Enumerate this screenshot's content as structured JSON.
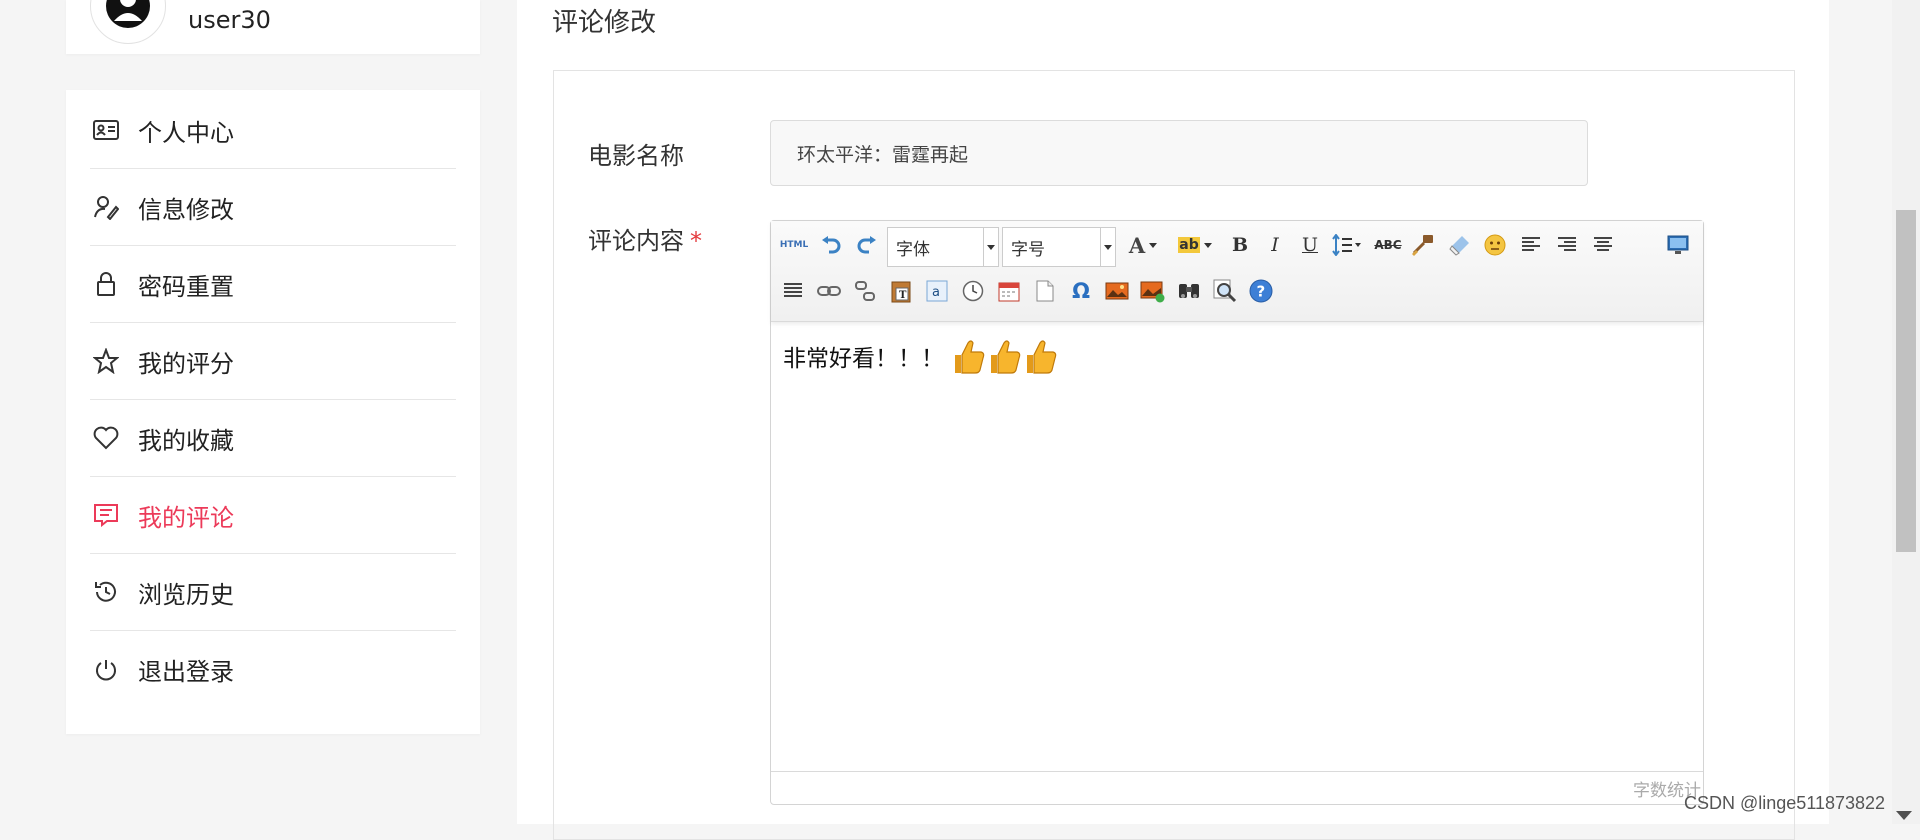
{
  "user": {
    "name": "user30"
  },
  "menu": {
    "items": [
      {
        "label": "个人中心",
        "icon": "id-card-icon"
      },
      {
        "label": "信息修改",
        "icon": "user-edit-icon"
      },
      {
        "label": "密码重置",
        "icon": "lock-icon"
      },
      {
        "label": "我的评分",
        "icon": "star-icon"
      },
      {
        "label": "我的收藏",
        "icon": "heart-icon"
      },
      {
        "label": "我的评论",
        "icon": "comment-icon",
        "active": true
      },
      {
        "label": "浏览历史",
        "icon": "history-icon"
      },
      {
        "label": "退出登录",
        "icon": "power-icon"
      }
    ],
    "active_color": "#ec3a59"
  },
  "main": {
    "title": "评论修改",
    "form": {
      "movie_label": "电影名称",
      "movie_value": "环太平洋：雷霆再起",
      "comment_label": "评论内容",
      "required_mark": "*"
    }
  },
  "editor": {
    "font_combo": "字体",
    "size_combo": "字号",
    "content_text": "非常好看！！！",
    "emoji_count": 3,
    "word_count_label": "字数统计",
    "toolbar_icons": [
      "html-source-icon",
      "undo-icon",
      "redo-icon",
      "font-color-icon",
      "highlight-color-icon",
      "bold-icon",
      "italic-icon",
      "underline-icon",
      "line-height-icon",
      "strikethrough-icon",
      "format-painter-icon",
      "eraser-icon",
      "emoticon-icon",
      "align-left-icon",
      "align-right-icon",
      "align-center-icon",
      "fullscreen-icon",
      "justify-icon",
      "link-icon",
      "unlink-icon",
      "paste-text-icon",
      "plain-text-icon",
      "anchor-icon",
      "time-icon",
      "date-icon",
      "page-break-icon",
      "special-char-icon",
      "image-icon",
      "multi-image-icon",
      "find-replace-icon",
      "preview-icon",
      "help-icon"
    ]
  },
  "watermark": "CSDN @linge511873822"
}
